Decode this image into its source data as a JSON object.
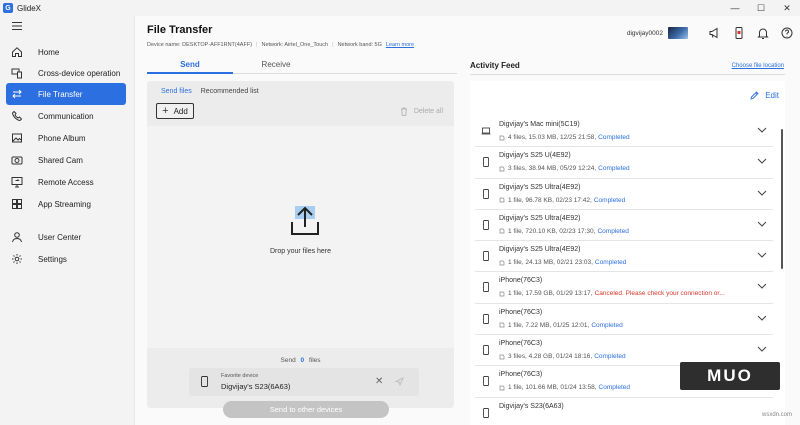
{
  "app": {
    "title": "GlideX",
    "logo_letter": "G"
  },
  "window_controls": {
    "minimize": "—",
    "maximize": "☐",
    "close": "✕"
  },
  "sidebar": {
    "items": [
      {
        "label": "Home",
        "icon": "home-icon",
        "active": false
      },
      {
        "label": "Cross-device operation",
        "icon": "cross-device-icon",
        "active": false
      },
      {
        "label": "File Transfer",
        "icon": "file-transfer-icon",
        "active": true
      },
      {
        "label": "Communication",
        "icon": "phone-icon",
        "active": false
      },
      {
        "label": "Phone Album",
        "icon": "album-icon",
        "active": false
      },
      {
        "label": "Shared Cam",
        "icon": "camera-icon",
        "active": false
      },
      {
        "label": "Remote Access",
        "icon": "remote-access-icon",
        "active": false
      },
      {
        "label": "App Streaming",
        "icon": "app-streaming-icon",
        "active": false
      },
      {
        "label": "User Center",
        "icon": "user-icon",
        "active": false
      },
      {
        "label": "Settings",
        "icon": "gear-icon",
        "active": false
      }
    ]
  },
  "header": {
    "title": "File Transfer",
    "device_name": "Device name: DESKTOP-AFF1RNT(4AFF)",
    "network": "Network: Airtel_One_Touch",
    "network_band": "Network band: 5G",
    "learn_more": "Learn more",
    "username": "digvijay0002"
  },
  "tabs": {
    "send": "Send",
    "receive": "Receive"
  },
  "send_panel": {
    "subtabs": {
      "send_files": "Send files",
      "recommended": "Recommended list"
    },
    "add_label": "Add",
    "delete_all_label": "Delete all",
    "drop_text": "Drop your files here",
    "send_prefix": "Send",
    "send_count": "0",
    "send_suffix": "files",
    "favorite_label": "Favorite device",
    "favorite_name": "Digvijay's S23(6A63)",
    "send_button": "Send to other devices"
  },
  "activity_feed": {
    "title": "Activity Feed",
    "choose_location": "Choose file location",
    "edit_label": "Edit",
    "items": [
      {
        "device": "Digvijay's Mac mini(5C19)",
        "type": "laptop",
        "meta": "4 files, 15.03 MB, 12/25 21:58,",
        "status": "Completed",
        "ok": true
      },
      {
        "device": "Digvijay's S25 U(4E92)",
        "type": "phone",
        "meta": "3 files, 38.94 MB, 05/29 12:24,",
        "status": "Completed",
        "ok": true
      },
      {
        "device": "Digvijay's S25 Ultra(4E92)",
        "type": "phone",
        "meta": "1 file, 96.78 KB, 02/23 17:42,",
        "status": "Completed",
        "ok": true
      },
      {
        "device": "Digvijay's S25 Ultra(4E92)",
        "type": "phone",
        "meta": "1 file, 720.10 KB, 02/23 17:30,",
        "status": "Completed",
        "ok": true
      },
      {
        "device": "Digvijay's S25 Ultra(4E92)",
        "type": "phone",
        "meta": "1 file, 24.13 MB, 02/21 23:03,",
        "status": "Completed",
        "ok": true
      },
      {
        "device": "iPhone(76C3)",
        "type": "phone",
        "meta": "1 file, 17.59 GB, 01/29 13:17,",
        "status": "Canceled. Please check your connection or...",
        "ok": false
      },
      {
        "device": "iPhone(76C3)",
        "type": "phone",
        "meta": "1 file, 7.22 MB, 01/25 12:01,",
        "status": "Completed",
        "ok": true
      },
      {
        "device": "iPhone(76C3)",
        "type": "phone",
        "meta": "3 files, 4.28 GB, 01/24 18:16,",
        "status": "Completed",
        "ok": true
      },
      {
        "device": "iPhone(76C3)",
        "type": "phone",
        "meta": "1 file, 101.66 MB, 01/24 13:58,",
        "status": "Completed",
        "ok": true
      },
      {
        "device": "Digvijay's S23(6A63)",
        "type": "phone",
        "meta": "",
        "status": "",
        "ok": true
      }
    ]
  },
  "watermark": {
    "logo": "MUO",
    "site": "wsxdn.com"
  },
  "colors": {
    "accent": "#2b6fe0",
    "error": "#d9362b",
    "sidebar_active": "#2b6fe0"
  }
}
